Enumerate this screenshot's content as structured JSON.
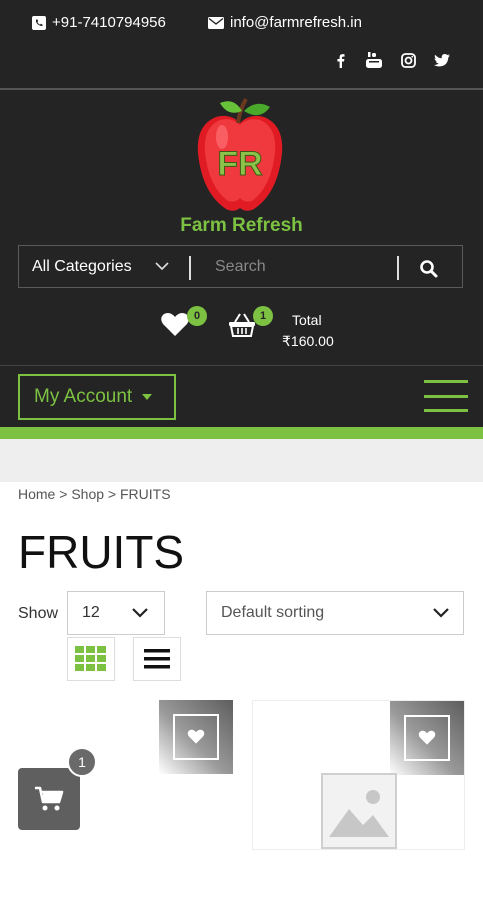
{
  "topbar": {
    "phone": "+91-7410794956",
    "email": "info@farmrefresh.in",
    "social_icons": [
      "facebook-icon",
      "youtube-icon",
      "instagram-icon",
      "twitter-icon"
    ]
  },
  "header": {
    "logo_monogram": "FR",
    "brand_name": "Farm Refresh",
    "search": {
      "category_label": "All Categories",
      "placeholder": "Search"
    },
    "wishlist_count": "0",
    "cart_count": "1",
    "total_label": "Total",
    "total_value": "₹160.00"
  },
  "nav": {
    "account_label": "My Account"
  },
  "breadcrumb": {
    "home": "Home",
    "sep": ">",
    "shop": "Shop",
    "current": "FRUITS"
  },
  "page_title": "FRUITS",
  "toolbar": {
    "show_label": "Show",
    "show_value": "12",
    "sort_value": "Default sorting"
  },
  "floating_cart_count": "1",
  "colors": {
    "accent": "#7cc142",
    "dark": "#242424",
    "light_band": "#eeeeee"
  }
}
